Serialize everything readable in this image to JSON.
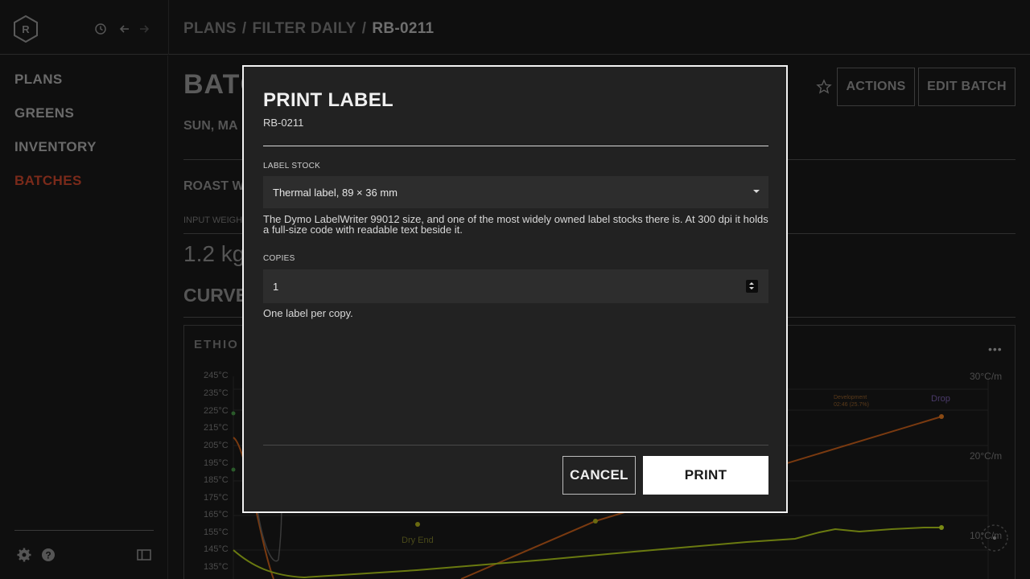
{
  "breadcrumb": {
    "items": [
      "PLANS",
      "FILTER DAILY",
      "RB-0211"
    ],
    "separator": "/"
  },
  "sidebar": {
    "items": [
      {
        "label": "PLANS",
        "active": false
      },
      {
        "label": "GREENS",
        "active": false
      },
      {
        "label": "INVENTORY",
        "active": false
      },
      {
        "label": "BATCHES",
        "active": true
      }
    ]
  },
  "background": {
    "title_visible": "BATC",
    "date_visible": "SUN, MA",
    "section_roast_visible": "ROAST W",
    "input_weight_label_visible": "INPUT WEIGH",
    "input_weight_value_visible": "1.2 kg",
    "curves_visible": "CURVE",
    "chart_title_visible": "ETHIO",
    "actions_label": "ACTIONS",
    "edit_label": "EDIT BATCH"
  },
  "chart_data": {
    "type": "line",
    "y_ticks": [
      "245°C",
      "235°C",
      "225°C",
      "215°C",
      "205°C",
      "195°C",
      "185°C",
      "175°C",
      "165°C",
      "155°C",
      "145°C",
      "135°C"
    ],
    "right_ticks": [
      "30°C/m",
      "20°C/m",
      "10°C/m"
    ],
    "annotations": {
      "drop": "Drop",
      "dry_end": "Dry End",
      "development": "Development",
      "development_time": "02:46 (25.7%)"
    }
  },
  "modal": {
    "title": "PRINT LABEL",
    "subtitle": "RB-0211",
    "label_stock": {
      "label": "LABEL STOCK",
      "value": "Thermal label, 89 × 36 mm",
      "help": "The Dymo LabelWriter 99012 size, and one of the most widely owned label stocks there is. At 300 dpi it holds a full-size code with readable text beside it."
    },
    "copies": {
      "label": "COPIES",
      "value": "1",
      "help": "One label per copy."
    },
    "cancel_label": "CANCEL",
    "print_label": "PRINT"
  },
  "colors": {
    "accent_active": "#7a2a1a",
    "modal_bg": "#222222",
    "modal_border": "#f2f2f2",
    "roast_curve": "#7a3a10",
    "ror_curve": "#6a7a10"
  }
}
